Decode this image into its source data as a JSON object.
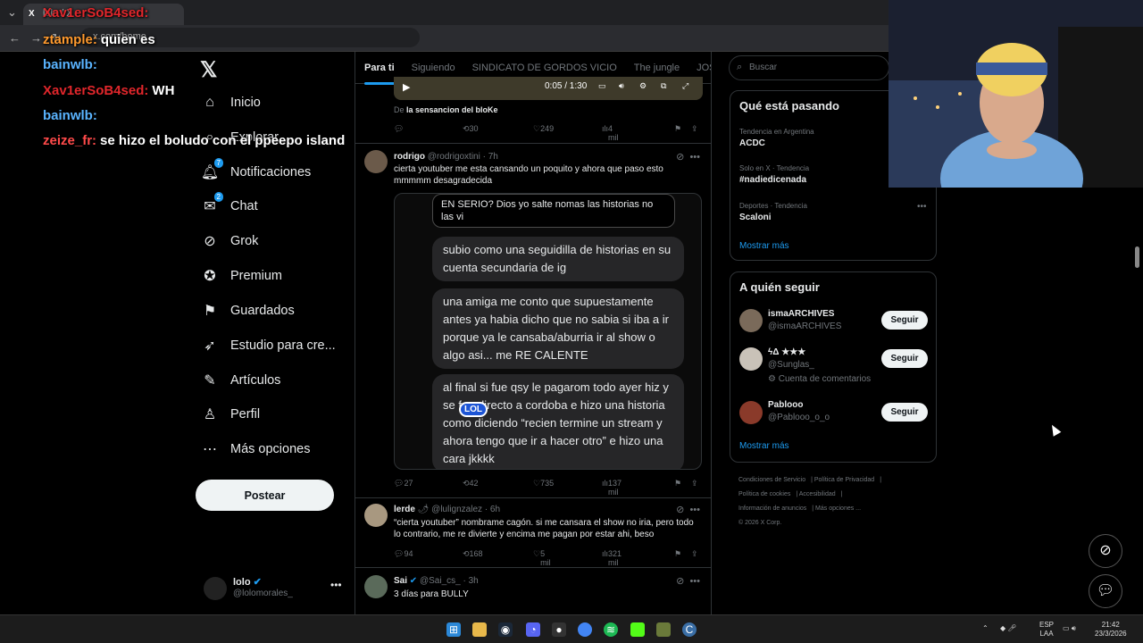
{
  "browser": {
    "tab_title": "lolo / X",
    "url": "x.com/home"
  },
  "chat": [
    {
      "user": "Xav1erSoB4sed:",
      "text": "",
      "color": "#e0262b"
    },
    {
      "user": "ztample:",
      "text": "quien es",
      "color": "#ff9a2e"
    },
    {
      "user": "bainwlb:",
      "text": "",
      "color": "#5ab4ff"
    },
    {
      "user": "Xav1erSoB4sed:",
      "text": "WH",
      "color": "#e0262b"
    },
    {
      "user": "bainwlb:",
      "text": "",
      "color": "#5ab4ff"
    },
    {
      "user": "zeize_fr:",
      "text": "se hizo el boludo con el ppeepo island",
      "color": "#ff4a4a"
    }
  ],
  "nav": {
    "items": [
      {
        "label": "Inicio",
        "icon": "home-icon"
      },
      {
        "label": "Explorar",
        "icon": "search-icon"
      },
      {
        "label": "Notificaciones",
        "icon": "bell-icon",
        "badge": "7"
      },
      {
        "label": "Chat",
        "icon": "mail-icon",
        "badge": "2"
      },
      {
        "label": "Grok",
        "icon": "grok-icon"
      },
      {
        "label": "Premium",
        "icon": "premium-icon"
      },
      {
        "label": "Guardados",
        "icon": "bookmark-icon"
      },
      {
        "label": "Estudio para cre...",
        "icon": "rocket-icon"
      },
      {
        "label": "Artículos",
        "icon": "articles-icon"
      },
      {
        "label": "Perfil",
        "icon": "person-icon"
      },
      {
        "label": "Más opciones",
        "icon": "more-circle-icon"
      }
    ],
    "post_label": "Postear",
    "profile": {
      "name": "lolo",
      "handle": "@lolomorales_"
    }
  },
  "feed": {
    "tabs": [
      "Para ti",
      "Siguiendo",
      "SINDICATO DE GORDOS VICIO",
      "The jungle",
      "JOSEO"
    ],
    "video": {
      "time": "0:05 / 1:30",
      "source_prefix": "De",
      "source": "la sensancion del bloKe",
      "stats": {
        "replies": "",
        "reposts": "30",
        "likes": "249",
        "views": "4 mil"
      }
    },
    "tweets": [
      {
        "name": "rodrigo",
        "handle": "@rodrigoxtini",
        "time": "· 7h",
        "text": "cierta youtuber me esta cansando un poquito y ahora que paso esto mmmmm desagradecida",
        "bubbles": [
          "EN SERIO? Dios yo salte nomas las historias no las vi",
          "subio como una seguidilla de historias en su cuenta secundaria de ig",
          "una amiga me conto que supuestamente antes ya habia dicho que no sabia si iba a ir porque ya le cansaba/aburria ir al show o algo asi... me RE CALENTE",
          "al final si fue qsy le pagarom todo ayer hiz  y se fue directo a cordoba e hizo una historia como diciendo “recien termine un stream y ahora tengo que ir a hacer otro” e hizo una cara jkkkk"
        ],
        "sticker": "LOL",
        "stats": {
          "replies": "27",
          "reposts": "42",
          "likes": "735",
          "views": "137 mil"
        }
      },
      {
        "name": "lerde",
        "handle": "@lulignzalez",
        "time": "· 6h",
        "text": "“cierta youtuber” nombrame cagón. si me cansara el show no iria, pero todo lo contrario, me re divierte y encima me pagan por estar ahi, beso",
        "stats": {
          "replies": "94",
          "reposts": "168",
          "likes": "5 mil",
          "views": "321 mil"
        }
      },
      {
        "name": "Sai",
        "handle": "@Sai_cs_",
        "time": "· 3h",
        "text": "3 días para BULLY"
      }
    ]
  },
  "sidebar": {
    "search_placeholder": "Buscar",
    "trends_title": "Qué está pasando",
    "trends": [
      {
        "category": "Tendencia en Argentina",
        "topic": "ACDC"
      },
      {
        "category": "Solo en X · Tendencia",
        "topic": "#nadiedicenada"
      },
      {
        "category": "Deportes · Tendencia",
        "topic": "Scaloni"
      }
    ],
    "show_more": "Mostrar más",
    "who_title": "A quién seguir",
    "who": [
      {
        "name": "ismaARCHIVES",
        "handle": "@ismaARCHIVES",
        "extra": ""
      },
      {
        "name": "ϟΔ ★★★",
        "handle": "@Sunglas_",
        "extra": "Cuenta de comentarios"
      },
      {
        "name": "Pablooo",
        "handle": "@Pablooo_o_o",
        "extra": ""
      }
    ],
    "follow_label": "Seguir",
    "footer": [
      "Condiciones de Servicio",
      "Política de Privacidad",
      "Política de cookies",
      "Accesibilidad",
      "Información de anuncios",
      "Más opciones ...",
      "© 2026 X Corp."
    ]
  },
  "taskbar": {
    "lang": "ESP",
    "lang2": "LAA",
    "time": "21:42",
    "date": "23/3/2026"
  },
  "colors": {
    "accent": "#1d9bf0",
    "background": "#000000",
    "border": "#2f3336"
  }
}
